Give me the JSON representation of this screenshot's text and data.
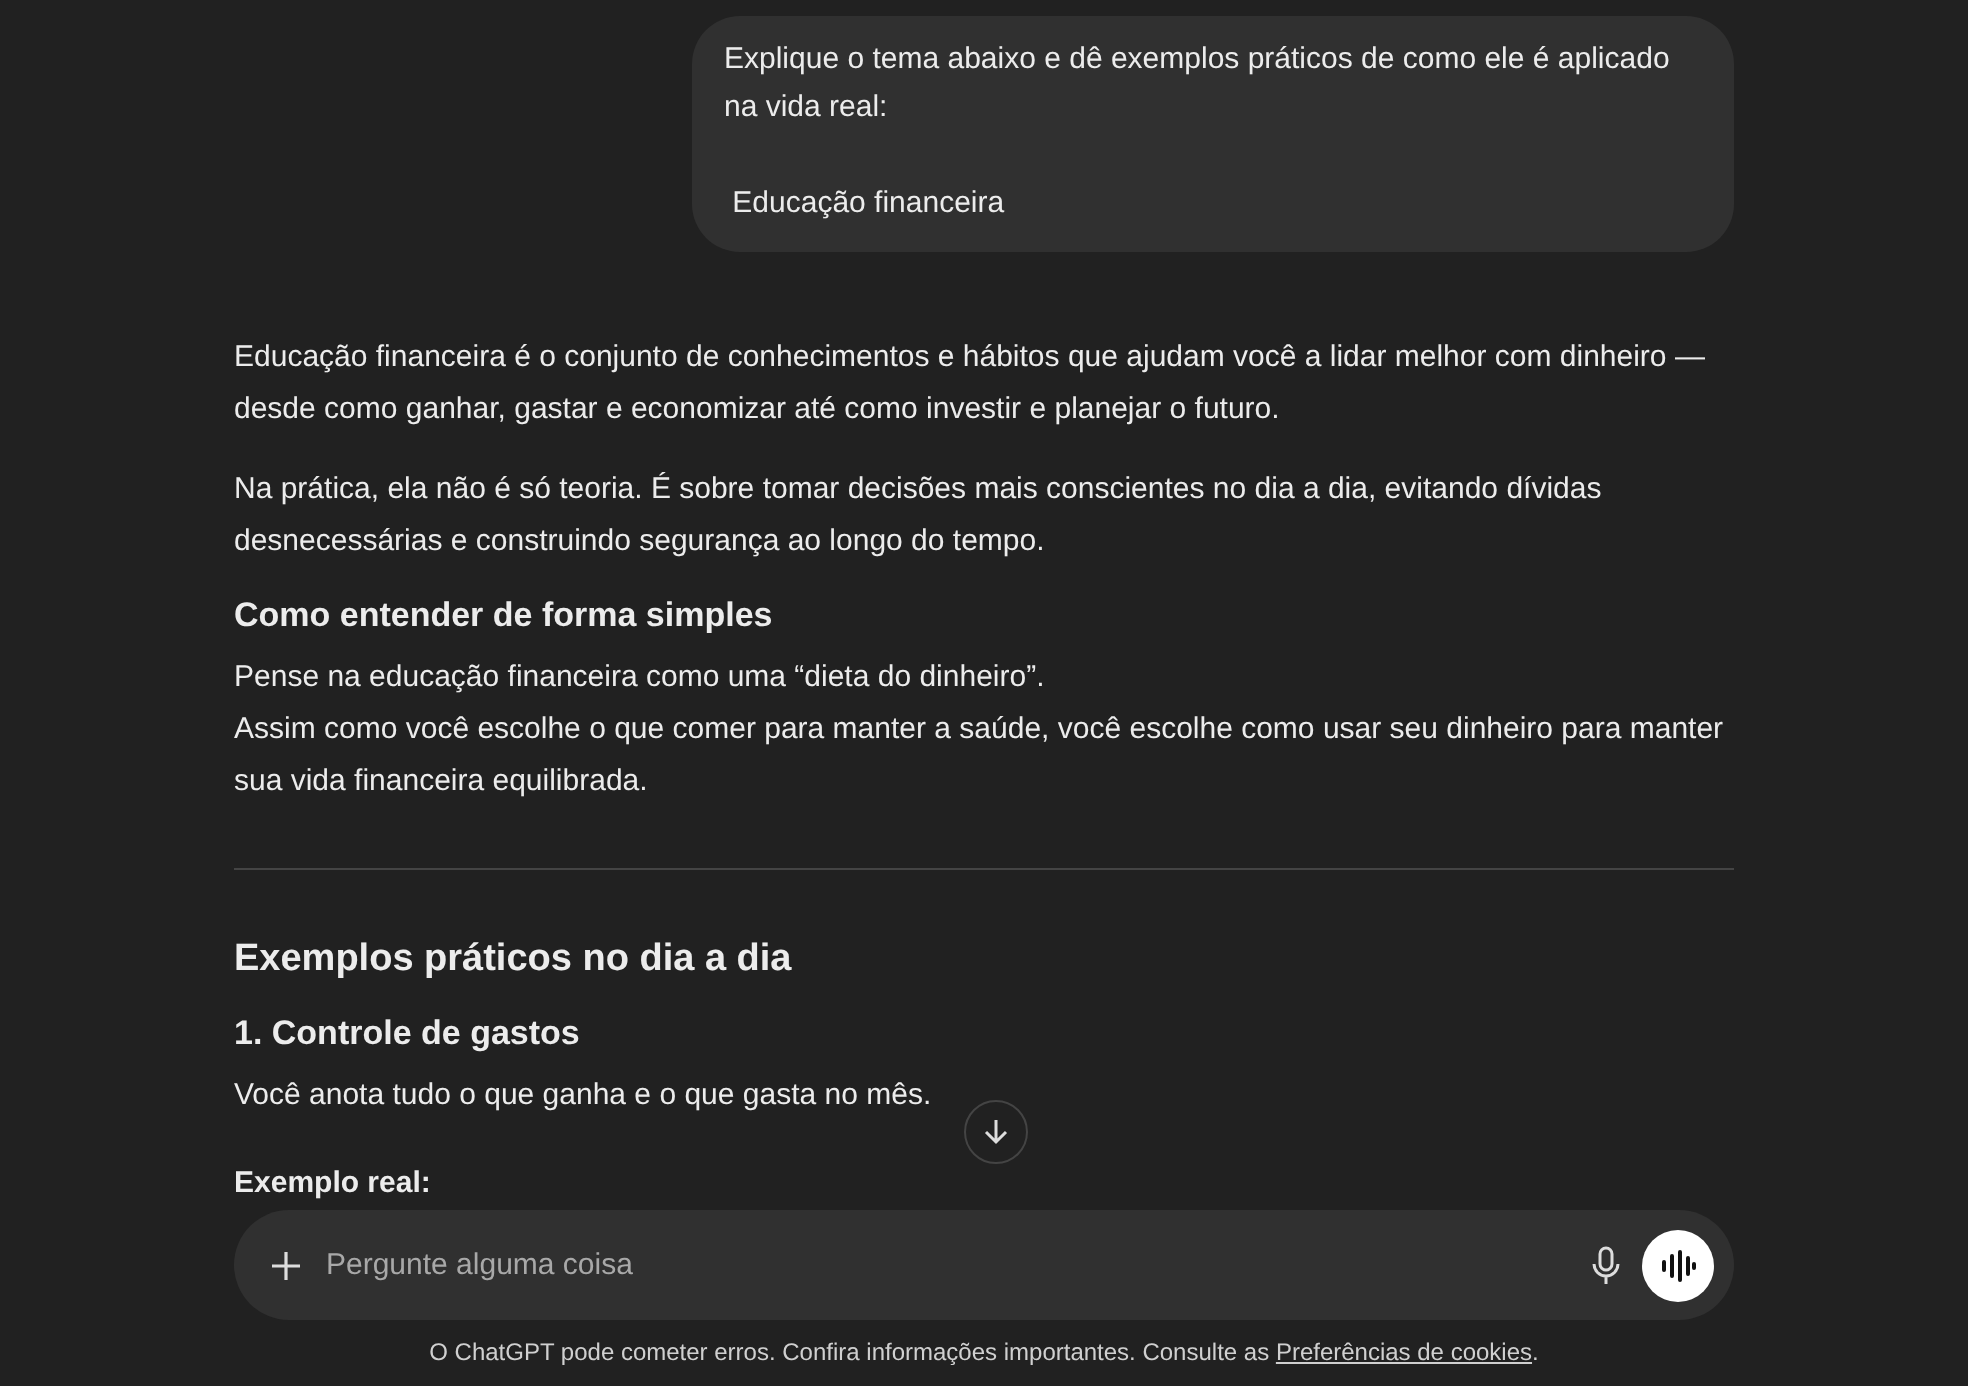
{
  "user_message": {
    "lines": [
      "Explique o tema abaixo e dê exemplos práticos de como ele é aplicado na vida real:",
      " Educação financeira"
    ]
  },
  "response": [
    {
      "kind": "paragraph",
      "lines": [
        "Educação financeira é o conjunto de conhecimentos e hábitos que ajudam você a lidar melhor com dinheiro — desde como ganhar, gastar e economizar até como investir e planejar o futuro."
      ]
    },
    {
      "kind": "paragraph",
      "lines": [
        "Na prática, ela não é só teoria. É sobre tomar decisões mais conscientes no dia a dia, evitando dívidas desnecessárias e construindo segurança ao longo do tempo."
      ]
    },
    {
      "kind": "subheading",
      "text": "Como entender de forma simples"
    },
    {
      "kind": "paragraph",
      "lines": [
        "Pense na educação financeira como uma “dieta do dinheiro”.",
        "Assim como você escolhe o que comer para manter a saúde, você escolhe como usar seu dinheiro para manter sua vida financeira equilibrada."
      ]
    },
    {
      "kind": "divider"
    },
    {
      "kind": "heading",
      "text": "Exemplos práticos no dia a dia"
    },
    {
      "kind": "subheading",
      "text": "1. Controle de gastos"
    },
    {
      "kind": "paragraph",
      "lines": [
        "Você anota tudo o que ganha e o que gasta no mês."
      ]
    },
    {
      "kind": "label",
      "text": "Exemplo real:"
    }
  ],
  "composer": {
    "placeholder": "Pergunte alguma coisa"
  },
  "footer": {
    "text": "O ChatGPT pode cometer erros. Confira informações importantes. Consulte as ",
    "link": "Preferências de cookies",
    "end": "."
  }
}
